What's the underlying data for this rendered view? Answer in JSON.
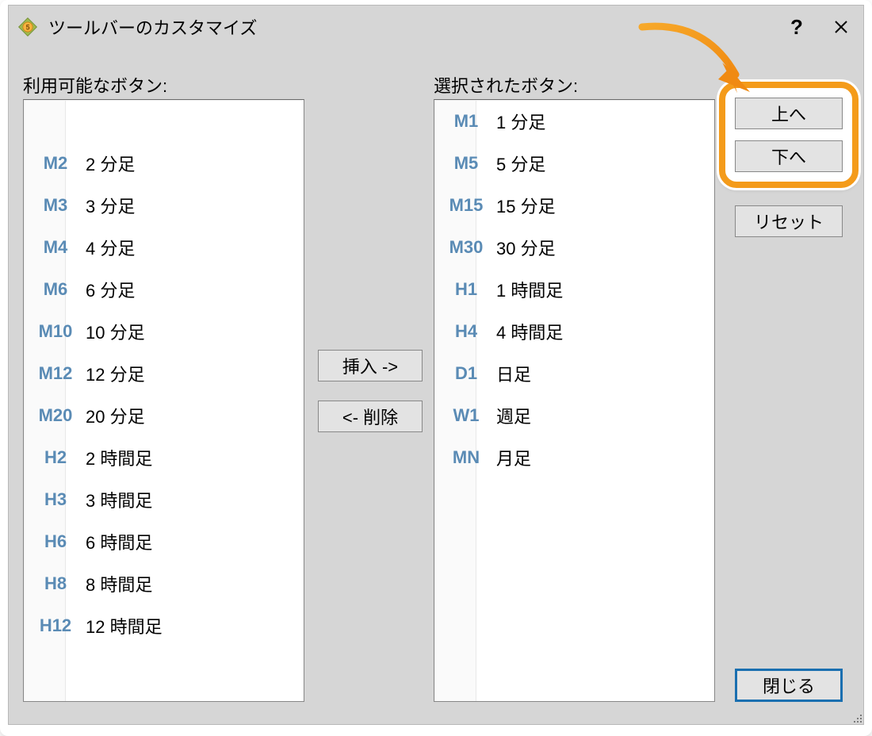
{
  "window": {
    "title": "ツールバーのカスタマイズ"
  },
  "labels": {
    "available": "利用可能なボタン:",
    "selected": "選択されたボタン:"
  },
  "buttons": {
    "insert": "挿入 ->",
    "remove": "<- 削除",
    "up": "上へ",
    "down": "下へ",
    "reset": "リセット",
    "close": "閉じる"
  },
  "available": [
    {
      "code": "",
      "desc": ""
    },
    {
      "code": "M2",
      "desc": "2 分足"
    },
    {
      "code": "M3",
      "desc": "3 分足"
    },
    {
      "code": "M4",
      "desc": "4 分足"
    },
    {
      "code": "M6",
      "desc": "6 分足"
    },
    {
      "code": "M10",
      "desc": "10 分足"
    },
    {
      "code": "M12",
      "desc": "12 分足"
    },
    {
      "code": "M20",
      "desc": "20 分足"
    },
    {
      "code": "H2",
      "desc": "2 時間足"
    },
    {
      "code": "H3",
      "desc": "3 時間足"
    },
    {
      "code": "H6",
      "desc": "6 時間足"
    },
    {
      "code": "H8",
      "desc": "8 時間足"
    },
    {
      "code": "H12",
      "desc": "12 時間足"
    }
  ],
  "selected": [
    {
      "code": "M1",
      "desc": "1 分足"
    },
    {
      "code": "M5",
      "desc": "5 分足"
    },
    {
      "code": "M15",
      "desc": "15 分足"
    },
    {
      "code": "M30",
      "desc": "30 分足"
    },
    {
      "code": "H1",
      "desc": "1 時間足"
    },
    {
      "code": "H4",
      "desc": "4 時間足"
    },
    {
      "code": "D1",
      "desc": "日足"
    },
    {
      "code": "W1",
      "desc": "週足"
    },
    {
      "code": "MN",
      "desc": "月足"
    }
  ]
}
